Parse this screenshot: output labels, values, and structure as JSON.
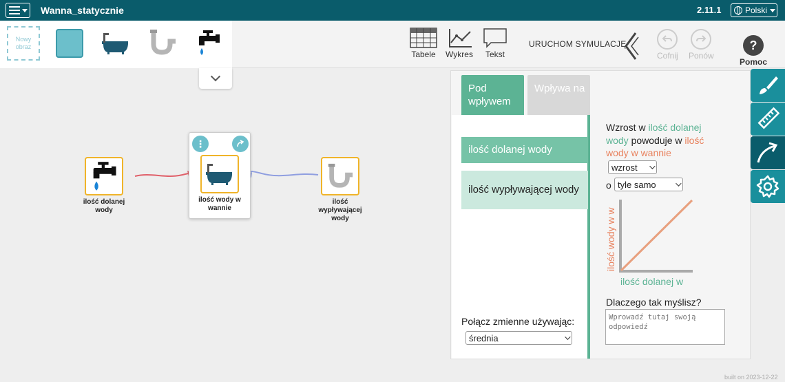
{
  "header": {
    "doc_title": "Wanna_statycznie",
    "version": "2.11.1",
    "language": "Polski"
  },
  "palette": {
    "new_image_label": "Nowy obraz",
    "items": [
      "blank-node",
      "bathtub-icon",
      "drain-pipe-icon",
      "faucet-icon"
    ]
  },
  "toolbar": {
    "tables": "Tabele",
    "graph": "Wykres",
    "text": "Tekst",
    "run_simulation": "URUCHOM SYMULACJĘ",
    "undo": "Cofnij",
    "redo": "Ponów",
    "help": "Pomoc"
  },
  "nodes": {
    "faucet": "ilość dolanej wody",
    "bathtub": "ilość wody w wannie",
    "drain": "ilość wypływającej wody"
  },
  "relation_panel": {
    "tab_active": "Pod wpływem",
    "tab_inactive": "Wpływa na",
    "variables": [
      "ilość dolanej wody",
      "ilość wypływającej wody"
    ],
    "sentence_prefix": "Wzrost w",
    "sentence_source": "ilość dolanej wody",
    "sentence_middle": "powoduje w",
    "sentence_target": "ilość wody w wannie",
    "effect_select": "wzrost",
    "o_label": "o",
    "amount_select": "tyle samo",
    "graph_y_label": "ilość wody w w",
    "graph_x_label": "ilość dolanej w",
    "why_label": "Dlaczego tak myślisz?",
    "why_placeholder": "Wprowadź tutaj swoją odpowiedź",
    "connect_label": "Połącz zmienne używając:",
    "connect_select": "średnia"
  },
  "side_tools": [
    "brush-icon",
    "ruler-icon",
    "relation-arrow-icon",
    "gear-icon"
  ],
  "footer": {
    "built": "built on 2023-12-22"
  },
  "colors": {
    "header_bg": "#0a5c6b",
    "accent_teal": "#6cbfcb",
    "green": "#5cb394",
    "orange": "#e8825e",
    "node_border": "#f0b429"
  }
}
